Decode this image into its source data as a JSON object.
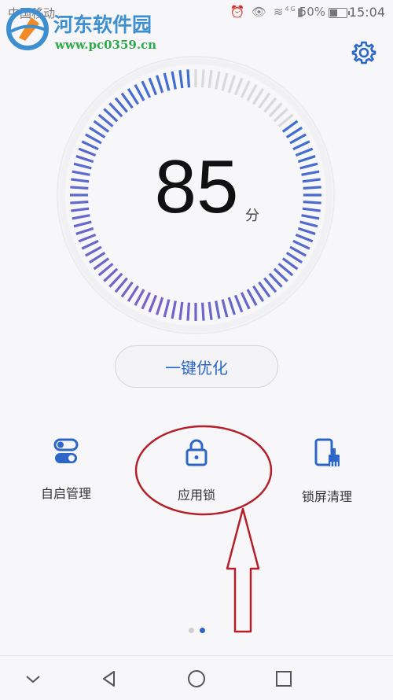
{
  "status_bar": {
    "carrier": "中国移动",
    "network": "4G",
    "battery_percent": "50%",
    "battery_level": 0.5,
    "time": "15:04"
  },
  "watermark": {
    "title": "河东软件园",
    "url": "www.pc0359.cn"
  },
  "score": {
    "value": "85",
    "unit": "分",
    "fraction": 0.85
  },
  "optimize_button": {
    "label": "一键优化"
  },
  "tools": [
    {
      "label": "自启管理",
      "icon": "toggle-switches-icon"
    },
    {
      "label": "应用锁",
      "icon": "padlock-icon"
    },
    {
      "label": "锁屏清理",
      "icon": "phone-broom-icon"
    }
  ],
  "page_indicator": {
    "count": 2,
    "active_index": 1
  },
  "colors": {
    "accent": "#2c67c8",
    "dial_active_start": "#3b6fd0",
    "dial_active_end": "#7a62c8",
    "dial_inactive": "#d9d9d9",
    "annotation": "#b3202a"
  },
  "nav": [
    {
      "icon": "chevron-down-icon"
    },
    {
      "icon": "back-triangle-icon"
    },
    {
      "icon": "home-circle-icon"
    },
    {
      "icon": "recents-square-icon"
    }
  ]
}
